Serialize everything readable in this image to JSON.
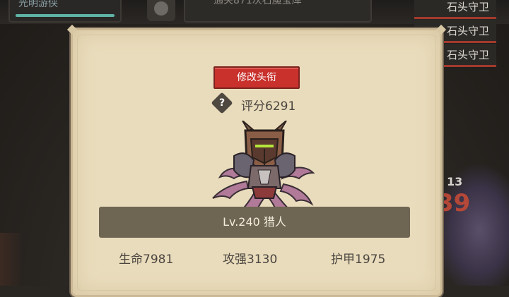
{
  "topbar": {
    "player_name": "光明游侠",
    "stage_text": "通关871次石魔宝库"
  },
  "guards": [
    "石头守卫",
    "石头守卫",
    "石头守卫"
  ],
  "scene": {
    "damage_large": "39",
    "damage_small": "13"
  },
  "dialog": {
    "title_button": "修改头衔",
    "help_icon": "?",
    "score_label": "评分6291",
    "hero_name": "Lv.240 猎人",
    "stats": {
      "hp": "生命7981",
      "attack": "攻强3130",
      "armor": "护甲1975"
    }
  },
  "colors": {
    "title_button": "#c8312c",
    "dialog_bg": "#e9dcbc",
    "name_bar": "#6e6552",
    "guard_underline": "#a23a2c",
    "player_bar": "#5fb3a6"
  }
}
